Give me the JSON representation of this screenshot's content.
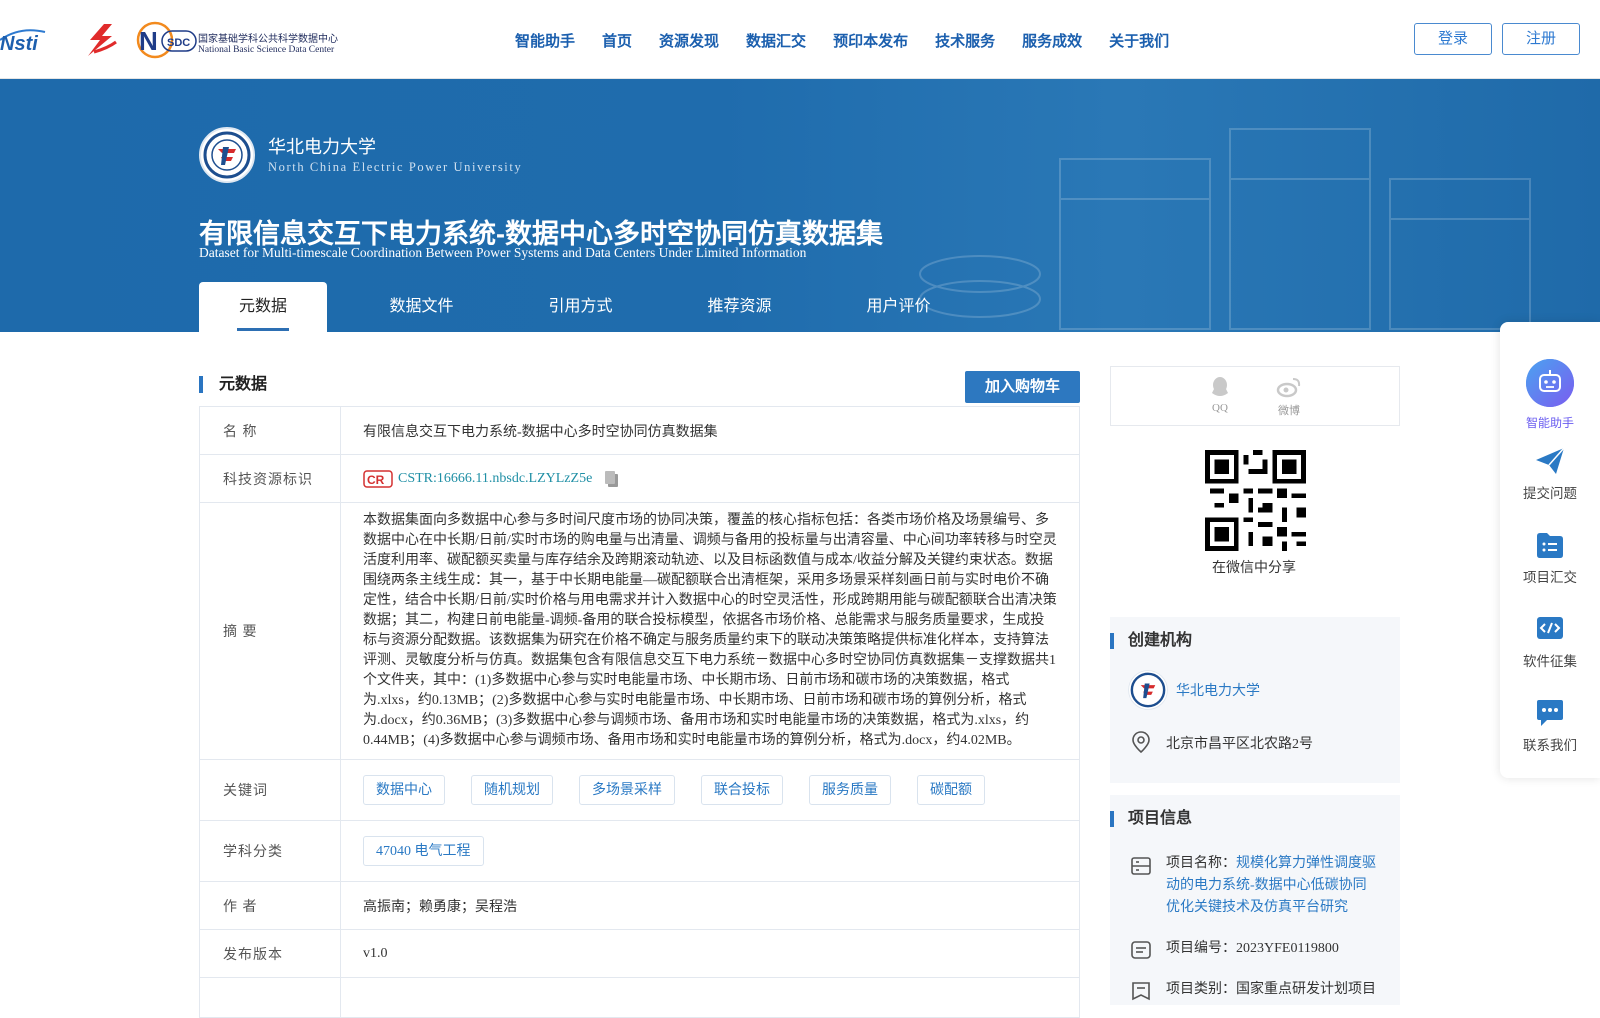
{
  "header": {
    "nav": [
      "智能助手",
      "首页",
      "资源发现",
      "数据汇交",
      "预印本发布",
      "技术服务",
      "服务成效",
      "关于我们"
    ],
    "login_label": "登录",
    "register_label": "注册",
    "logo_nstl_text": "Nsti",
    "logo_nsdc_cn": "国家基础学科公共科学数据中心",
    "logo_nsdc_en": "National Basic Science Data Center",
    "logo_nsdc_mark": "SDC"
  },
  "banner": {
    "university_name": "华北电力大学",
    "university_en": "North China Electric Power University",
    "dataset_title": "有限信息交互下电力系统-数据中心多时空协同仿真数据集",
    "dataset_title_en": "Dataset for Multi-timescale Coordination Between Power Systems and Data Centers Under Limited Information",
    "tabs": [
      "元数据",
      "数据文件",
      "引用方式",
      "推荐资源",
      "用户评价"
    ]
  },
  "metadata": {
    "section_title": "元数据",
    "cart_label": "加入购物车",
    "rows": {
      "name_key": "名 称",
      "name_value": "有限信息交互下电力系统-数据中心多时空协同仿真数据集",
      "id_key": "科技资源标识",
      "id_value": "CSTR:16666.11.nbsdc.LZYLzZ5e",
      "abstract_key": "摘 要",
      "abstract_value": "本数据集面向多数据中心参与多时间尺度市场的协同决策，覆盖的核心指标包括：各类市场价格及场景编号、多数据中心在中长期/日前/实时市场的购电量与出清量、调频与备用的投标量与出清容量、中心间功率转移与时空灵活度利用率、碳配额买卖量与库存结余及跨期滚动轨迹、以及目标函数值与成本/收益分解及关键约束状态。数据围绕两条主线生成：其一，基于中长期电能量—碳配额联合出清框架，采用多场景采样刻画日前与实时电价不确定性，结合中长期/日前/实时价格与用电需求并计入数据中心的时空灵活性，形成跨期用能与碳配额联合出清决策数据；其二，构建日前电能量-调频-备用的联合投标模型，依据各市场价格、总能需求与服务质量要求，生成投标与资源分配数据。该数据集为研究在价格不确定与服务质量约束下的联动决策策略提供标准化样本，支持算法评测、灵敏度分析与仿真。数据集包含有限信息交互下电力系统－数据中心多时空协同仿真数据集－支撑数据共1个文件夹，其中：(1)多数据中心参与实时电能量市场、中长期市场、日前市场和碳市场的决策数据，格式为.xlxs，约0.13MB；(2)多数据中心参与实时电能量市场、中长期市场、日前市场和碳市场的算例分析，格式为.docx，约0.36MB；(3)多数据中心参与调频市场、备用市场和实时电能量市场的决策数据，格式为.xlxs，约0.44MB；(4)多数据中心参与调频市场、备用市场和实时电能量市场的算例分析，格式为.docx，约4.02MB。",
      "keywords_key": "关键词",
      "keywords": [
        "数据中心",
        "随机规划",
        "多场景采样",
        "联合投标",
        "服务质量",
        "碳配额"
      ],
      "subject_key": "学科分类",
      "subject_value": "47040 电气工程",
      "author_key": "作 者",
      "author_value": "高振南；赖勇康；吴程浩",
      "version_key": "发布版本",
      "version_value": "v1.0"
    }
  },
  "share": {
    "qq_label": "QQ",
    "weibo_label": "微博",
    "wechat_label": "在微信中分享"
  },
  "org": {
    "title": "创建机构",
    "name": "华北电力大学",
    "address": "北京市昌平区北农路2号"
  },
  "project": {
    "title": "项目信息",
    "name_label": "项目名称：",
    "name_value": "规模化算力弹性调度驱动的电力系统-数据中心低碳协同优化关键技术及仿真平台研究",
    "code_label": "项目编号：",
    "code_value": "2023YFE0119800",
    "type_label": "项目类别：",
    "type_value": "国家重点研发计划项目"
  },
  "float_bar": [
    "智能助手",
    "提交问题",
    "项目汇交",
    "软件征集",
    "联系我们"
  ],
  "colors": {
    "primary": "#1e6aab",
    "accent": "#2a79c4",
    "ai_purple": "#6a5cf0"
  }
}
